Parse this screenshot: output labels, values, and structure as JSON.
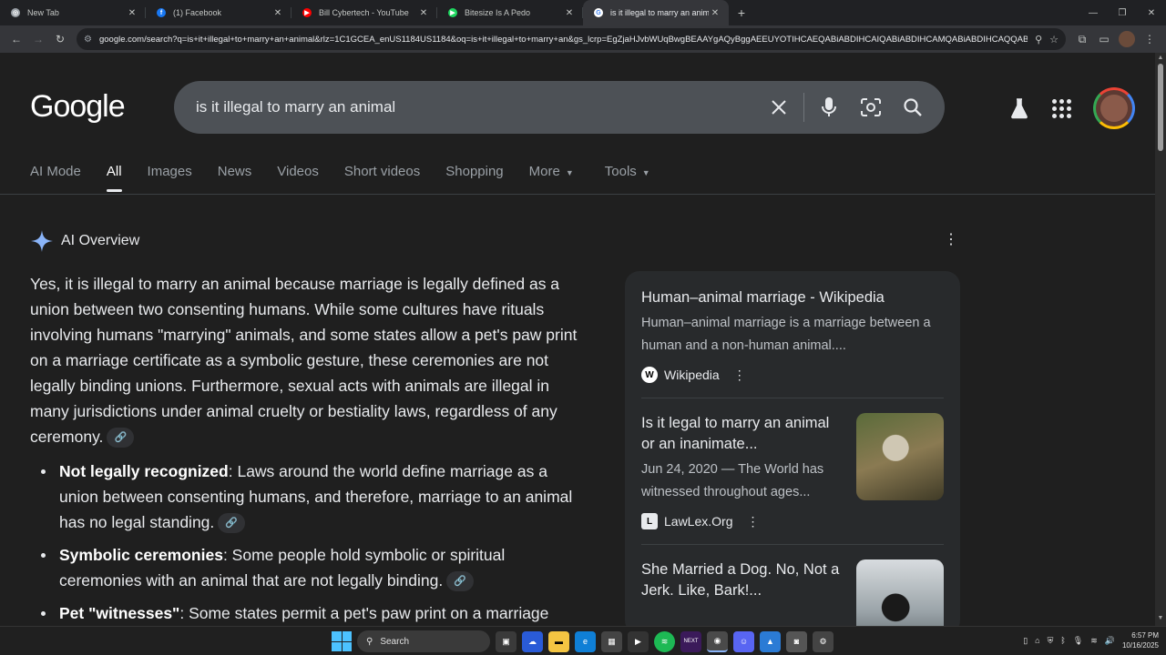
{
  "browser": {
    "tabs": [
      {
        "title": "New Tab",
        "color": "#9aa0a6",
        "glyph": "◎",
        "active": false
      },
      {
        "title": "(1) Facebook",
        "color": "#1877f2",
        "glyph": "f",
        "active": false
      },
      {
        "title": "Bill Cybertech - YouTube",
        "color": "#ff0000",
        "glyph": "▶",
        "active": false
      },
      {
        "title": "Bitesize Is A Pedo",
        "color": "#1ed760",
        "glyph": "▶",
        "active": false
      },
      {
        "title": "is it illegal to marry an animal",
        "color": "#ffffff",
        "glyph": "G",
        "active": true
      }
    ],
    "url": "google.com/search?q=is+it+illegal+to+marry+an+animal&rlz=1C1GCEA_enUS1184US1184&oq=is+it+illegal+to+marry+an&gs_lcrp=EgZjaHJvbWUqBwgBEAAYgAQyBggAEEUYOTIHCAEQABiABDIHCAIQABiABDIHCAMQABiABDIHCAQQABiA..."
  },
  "header": {
    "logo": "Google",
    "query": "is it illegal to marry an animal"
  },
  "nav": {
    "tabs": [
      {
        "label": "AI Mode",
        "active": false,
        "caret": false
      },
      {
        "label": "All",
        "active": true,
        "caret": false
      },
      {
        "label": "Images",
        "active": false,
        "caret": false
      },
      {
        "label": "News",
        "active": false,
        "caret": false
      },
      {
        "label": "Videos",
        "active": false,
        "caret": false
      },
      {
        "label": "Short videos",
        "active": false,
        "caret": false
      },
      {
        "label": "Shopping",
        "active": false,
        "caret": false
      },
      {
        "label": "More",
        "active": false,
        "caret": true
      },
      {
        "label": "Tools",
        "active": false,
        "caret": true
      }
    ]
  },
  "ai_overview": {
    "heading": "AI Overview",
    "summary": "Yes, it is illegal to marry an animal because marriage is legally defined as a union between two consenting humans. While some cultures have rituals involving humans \"marrying\" animals, and some states allow a pet's paw print on a marriage certificate as a symbolic gesture, these ceremonies are not legally binding unions. Furthermore, sexual acts with animals are illegal in many jurisdictions under animal cruelty or bestiality laws, regardless of any ceremony.",
    "points": [
      {
        "term": "Not legally recognized",
        "text": ": Laws around the world define marriage as a union between consenting humans, and therefore, marriage to an animal has no legal standing."
      },
      {
        "term": "Symbolic ceremonies",
        "text": ": Some people hold symbolic or spiritual ceremonies with an animal that are not legally binding."
      },
      {
        "term": "Pet \"witnesses\"",
        "text": ": Some states permit a pet's paw print on a marriage"
      }
    ]
  },
  "sources": [
    {
      "title": "Human–animal marriage - Wikipedia",
      "snippet": "Human–animal marriage is a marriage between a human and a non-human animal....",
      "site": "Wikipedia",
      "site_glyph": "W",
      "has_image": false
    },
    {
      "title": "Is it legal to marry an animal or an inanimate...",
      "snippet": "Jun 24, 2020 — The World has witnessed throughout ages...",
      "site": "LawLex.Org",
      "site_glyph": "L",
      "has_image": true
    },
    {
      "title": "She Married a Dog. No, Not a Jerk. Like, Bark!...",
      "snippet": "",
      "site": "",
      "site_glyph": "",
      "has_image": true
    }
  ],
  "taskbar": {
    "search_label": "Search",
    "time": "6:57 PM",
    "date": "10/16/2025"
  }
}
